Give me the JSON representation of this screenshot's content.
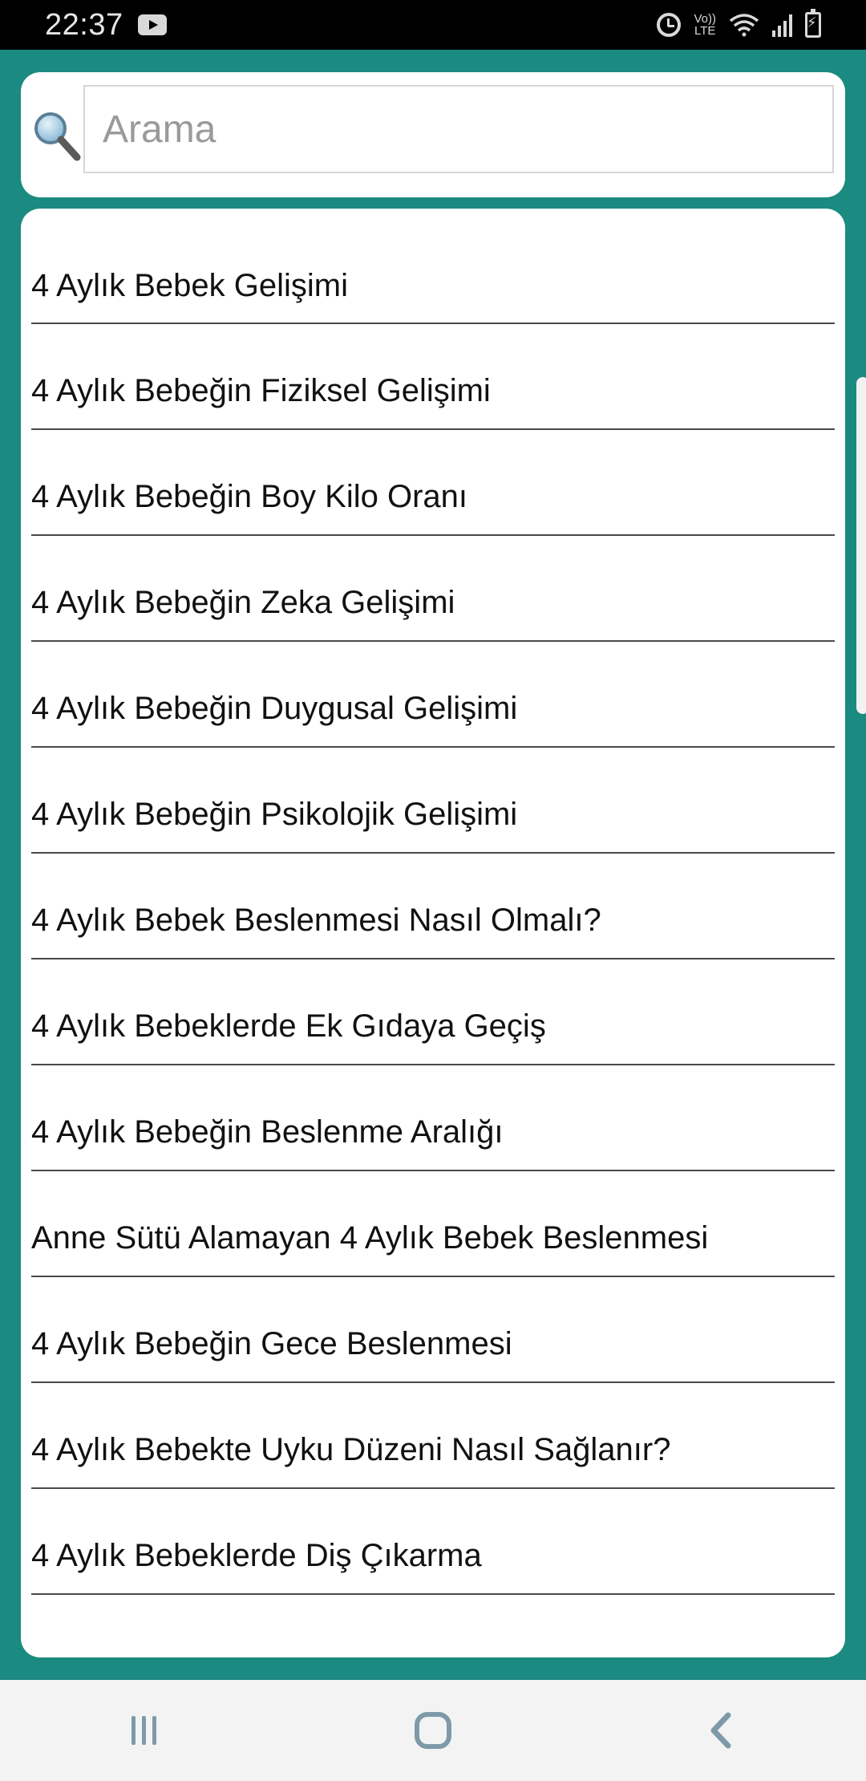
{
  "status_bar": {
    "time": "22:37",
    "volte_label_top": "Vo))",
    "volte_label_bottom": "LTE",
    "icons": [
      "youtube-icon",
      "alarm-icon",
      "volte-icon",
      "wifi-icon",
      "signal-icon",
      "battery-charging-icon"
    ]
  },
  "search": {
    "placeholder": "Arama",
    "value": ""
  },
  "list": {
    "items": [
      "4 Aylık Bebek Gelişimi",
      "4 Aylık Bebeğin Fiziksel Gelişimi",
      "4 Aylık Bebeğin Boy Kilo Oranı",
      "4 Aylık Bebeğin Zeka Gelişimi",
      "4 Aylık Bebeğin Duygusal Gelişimi",
      "4 Aylık Bebeğin Psikolojik Gelişimi",
      "4 Aylık Bebek Beslenmesi Nasıl Olmalı?",
      "4 Aylık Bebeklerde Ek Gıdaya Geçiş",
      "4 Aylık Bebeğin Beslenme Aralığı",
      "Anne Sütü Alamayan 4 Aylık Bebek Beslenmesi",
      "4 Aylık Bebeğin Gece Beslenmesi",
      "4 Aylık Bebekte Uyku Düzeni Nasıl Sağlanır?",
      "4 Aylık Bebeklerde Diş Çıkarma"
    ]
  },
  "colors": {
    "background": "#1b8a80",
    "card": "#ffffff",
    "divider": "#4a4a4a",
    "status_bar": "#000000",
    "nav_bar": "#f3f3f3",
    "nav_icon": "#7e9aa8"
  },
  "nav_bar": {
    "icons": [
      "recent-apps-icon",
      "home-icon",
      "back-icon"
    ]
  }
}
